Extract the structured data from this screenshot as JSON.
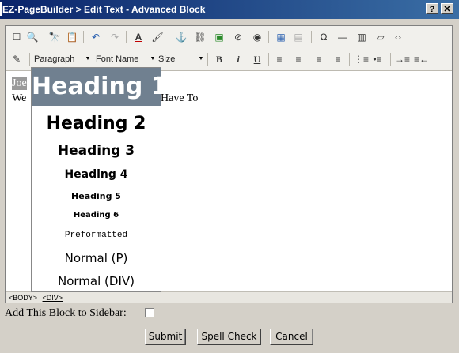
{
  "window": {
    "title": "EZ-PageBuilder > Edit Text - Advanced Block",
    "help_label": "?",
    "close_label": "✕"
  },
  "toolbar1": {
    "icons": [
      "new-page-icon",
      "preview-icon",
      "find-icon",
      "paste-icon",
      "undo-icon",
      "redo-icon",
      "text-color-icon",
      "highlight-icon",
      "anchor-icon",
      "link-icon",
      "image-icon",
      "flash-icon",
      "media-icon",
      "table-icon",
      "table-properties-icon",
      "special-char-icon",
      "horizontal-rule-icon",
      "form-icon",
      "eraser-icon",
      "source-code-icon"
    ],
    "glyphs": [
      "☐",
      "🔍",
      "🔭",
      "📋",
      "↶",
      "↷",
      "A",
      "🖌",
      "⚓",
      "⛓",
      "▣",
      "⊘",
      "◉",
      "▦",
      "▤",
      "Ω",
      "—",
      "▥",
      "▱",
      "‹›"
    ]
  },
  "toolbar2": {
    "format_value": "Paragraph",
    "font_value": "Font Name",
    "size_value": "Size",
    "bold": "B",
    "italic": "i",
    "underline": "U",
    "icons": [
      "align-left-icon",
      "align-center-icon",
      "align-right-icon",
      "justify-icon",
      "ordered-list-icon",
      "unordered-list-icon",
      "indent-icon",
      "outdent-icon"
    ],
    "glyphs": [
      "≡",
      "≡",
      "≡",
      "≡",
      "⋮≡",
      "•≡",
      "→≡",
      "≡←"
    ]
  },
  "editor": {
    "line1": "Joe",
    "line2_start": "We",
    "line2_end": "Have To"
  },
  "status": {
    "body_tag": "<BODY>",
    "div_tag": "<DIV>"
  },
  "dropdown": {
    "items": [
      "Heading 1",
      "Heading 2",
      "Heading 3",
      "Heading 4",
      "Heading 5",
      "Heading 6",
      "Preformatted",
      "Normal (P)",
      "Normal (DIV)"
    ],
    "selected_color": "#708090"
  },
  "form": {
    "sidebar_label": "Add This Block to Sidebar:",
    "sidebar_checked": false,
    "submit_label": "Submit",
    "spellcheck_label": "Spell Check",
    "cancel_label": "Cancel"
  }
}
